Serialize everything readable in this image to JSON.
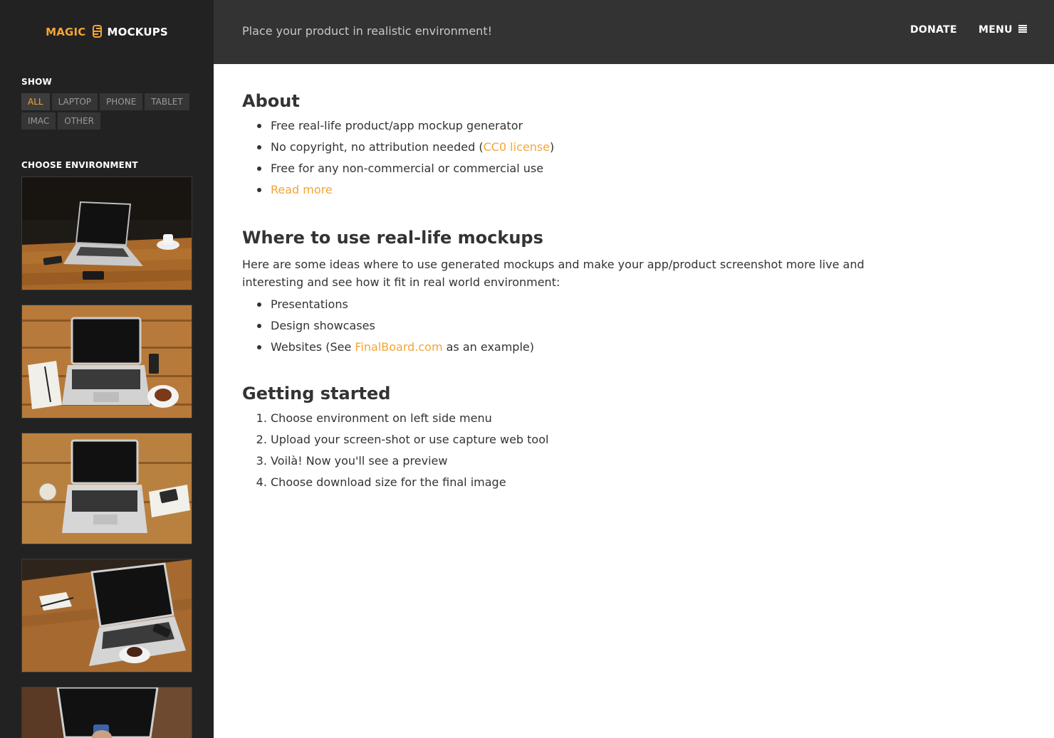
{
  "logo": {
    "part1": "MAGIC",
    "part2": "MOCKUPS"
  },
  "sidebar": {
    "show_title": "SHOW",
    "filters": [
      "ALL",
      "LAPTOP",
      "PHONE",
      "TABLET",
      "IMAC",
      "OTHER"
    ],
    "active_filter": "ALL",
    "env_title": "CHOOSE ENVIRONMENT",
    "environments": [
      "Laptop on dark wooden table with coffee cup",
      "Laptop on wooden table with notebook, phone and coffee",
      "Laptop on wooden floor with glass and phone",
      "Laptop on table at angle with notebook and coffee",
      "Laptop with hand holding phone"
    ]
  },
  "header": {
    "tagline": "Place your product in realistic environment!",
    "donate": "DONATE",
    "menu": "MENU"
  },
  "about": {
    "title": "About",
    "items": [
      "Free real-life product/app mockup generator",
      "No copyright, no attribution needed (",
      "CC0 license",
      ")",
      "Free for any non-commercial or commercial use",
      "Read more"
    ]
  },
  "where": {
    "title": "Where to use real-life mockups",
    "intro": "Here are some ideas where to use generated mockups and make your app/product screenshot more live and interesting and see how it fit in real world environment:",
    "items": [
      "Presentations",
      "Design showcases",
      "Websites (See ",
      "FinalBoard.com",
      " as an example)"
    ]
  },
  "getting_started": {
    "title": "Getting started",
    "steps": [
      "Choose environment on left side menu",
      "Upload your screen-shot or use capture web tool",
      "Voilà! Now you'll see a preview",
      "Choose download size for the final image"
    ]
  },
  "colors": {
    "accent": "#f4a536",
    "sidebar": "#222222",
    "topbar": "#333333"
  }
}
